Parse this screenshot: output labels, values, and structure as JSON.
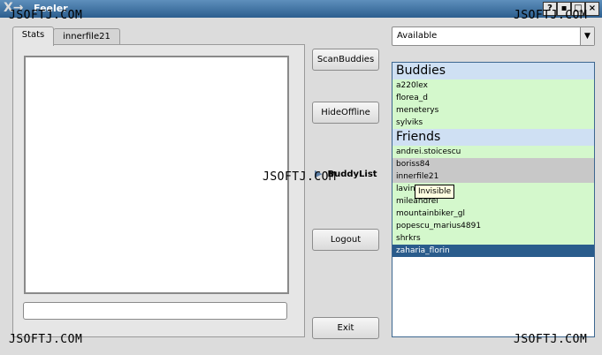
{
  "window": {
    "logo": "X→",
    "title": "Feeler",
    "controls": [
      "?",
      "▪",
      "□",
      "×"
    ]
  },
  "watermark": "JSOFTJ.COM",
  "tabs": [
    {
      "label": "Stats",
      "active": true
    },
    {
      "label": "innerfile21",
      "active": false
    }
  ],
  "buttons": {
    "scan": "ScanBuddies",
    "hide": "HideOffline",
    "logout": "Logout",
    "exit": "Exit"
  },
  "buddylist_label": "BuddyList",
  "status": {
    "selected": "Available"
  },
  "groups": [
    {
      "name": "Buddies",
      "members": [
        {
          "name": "a220lex",
          "state": "online"
        },
        {
          "name": "florea_d",
          "state": "online"
        },
        {
          "name": "meneterys",
          "state": "online"
        },
        {
          "name": "sylviks",
          "state": "online"
        }
      ]
    },
    {
      "name": "Friends",
      "members": [
        {
          "name": "andrei.stoicescu",
          "state": "online"
        },
        {
          "name": "boriss84",
          "state": "offline"
        },
        {
          "name": "innerfile21",
          "state": "offline"
        },
        {
          "name": "lavin",
          "state": "online"
        },
        {
          "name": "mileandrei",
          "state": "online"
        },
        {
          "name": "mountainbiker_gl",
          "state": "online"
        },
        {
          "name": "popescu_marius4891",
          "state": "online"
        },
        {
          "name": "shrkrs",
          "state": "online"
        },
        {
          "name": "zaharia_florin",
          "state": "selected"
        }
      ]
    }
  ],
  "tooltip": "Invisible",
  "colors": {
    "online": "#d4f8cc",
    "offline": "#c8c8c8",
    "selected": "#2a5c8c",
    "group_header": "#cfe0f3"
  }
}
